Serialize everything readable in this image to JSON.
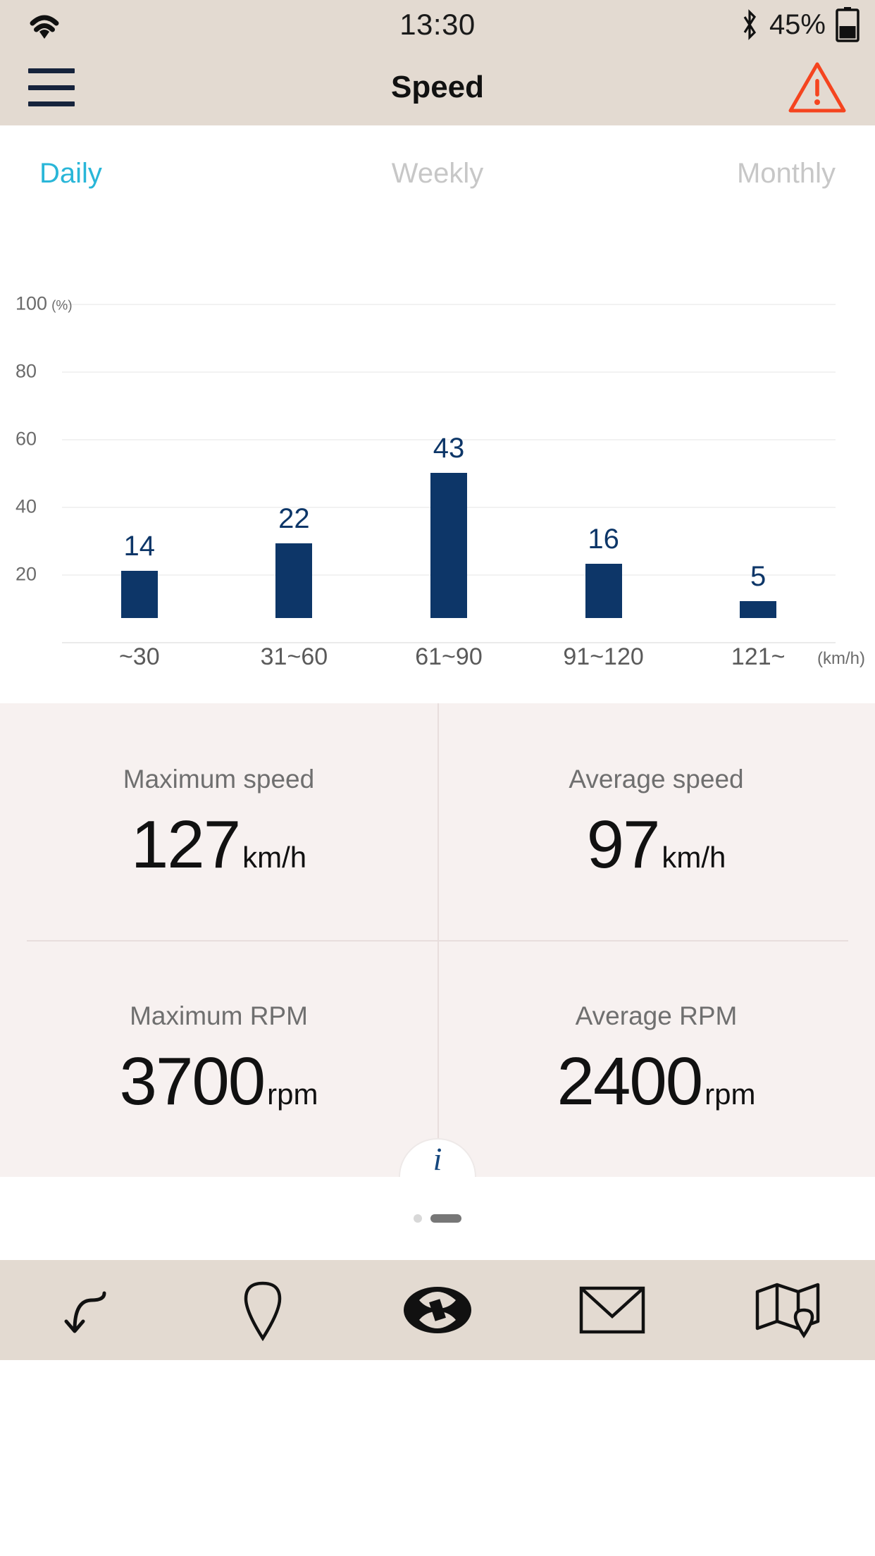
{
  "status_bar": {
    "wifi_icon": "wifi-icon",
    "clock": "13:30",
    "bluetooth_icon": "bluetooth-icon",
    "battery_percent": "45%",
    "battery_icon": "battery-icon"
  },
  "header": {
    "menu_icon": "hamburger-menu-icon",
    "title": "Speed",
    "warning_icon": "warning-triangle-icon"
  },
  "tabs": [
    {
      "label": "Daily",
      "active": true
    },
    {
      "label": "Weekly",
      "active": false
    },
    {
      "label": "Monthly",
      "active": false
    }
  ],
  "chart_data": {
    "type": "bar",
    "title": "",
    "categories": [
      "~30",
      "31~60",
      "61~90",
      "91~120",
      "121~"
    ],
    "values": [
      14,
      22,
      43,
      16,
      5
    ],
    "bar_labels": [
      "14",
      "22",
      "43",
      "16",
      "5"
    ],
    "xlabel": "(km/h)",
    "ylabel": "(%)",
    "ylim": [
      0,
      100
    ],
    "yticks": [
      100,
      80,
      60,
      40,
      20
    ],
    "ytick_labels": [
      "100",
      "80",
      "60",
      "40",
      "20"
    ],
    "y_unit": "(%)",
    "grid": true,
    "legend": "none",
    "bar_color": "#0d3668",
    "label_color": "#0d3668"
  },
  "stats": [
    {
      "label": "Maximum speed",
      "value": "127",
      "unit": "km/h"
    },
    {
      "label": "Average speed",
      "value": "97",
      "unit": "km/h"
    },
    {
      "label": "Maximum RPM",
      "value": "3700",
      "unit": "rpm"
    },
    {
      "label": "Average RPM",
      "value": "2400",
      "unit": "rpm"
    }
  ],
  "info_button": {
    "glyph": "i",
    "icon": "info-icon"
  },
  "bottom_nav": [
    {
      "icon": "back-arrow-icon"
    },
    {
      "icon": "location-pin-icon"
    },
    {
      "icon": "hyundai-logo-icon"
    },
    {
      "icon": "mail-envelope-icon"
    },
    {
      "icon": "map-icon"
    }
  ],
  "colors": {
    "header_bg": "#e3dad1",
    "accent_cyan": "#29b6d8",
    "bar_navy": "#0d3668",
    "warning_red": "#f5441f",
    "stats_bg": "#f7f1f0"
  }
}
